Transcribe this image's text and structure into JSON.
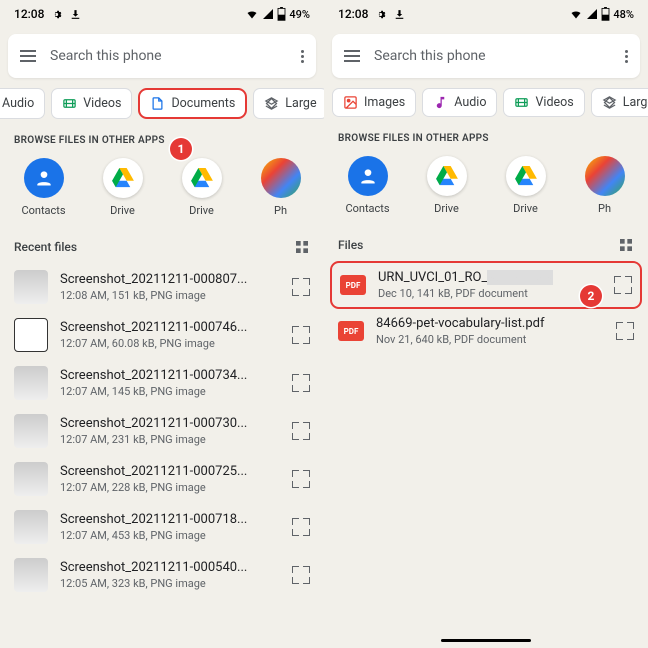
{
  "left": {
    "status": {
      "time": "12:08",
      "battery": "49%"
    },
    "search": {
      "placeholder": "Search this phone"
    },
    "chips": [
      {
        "icon": "audio",
        "label": "Audio",
        "color": "#9c27b0"
      },
      {
        "icon": "videos",
        "label": "Videos",
        "color": "#0f9d58"
      },
      {
        "icon": "documents",
        "label": "Documents",
        "color": "#1a73e8",
        "highlight": true
      },
      {
        "icon": "large",
        "label": "Large",
        "color": "#5f6368"
      }
    ],
    "browse_title": "BROWSE FILES IN OTHER APPS",
    "apps": [
      {
        "name": "Contacts",
        "type": "contacts"
      },
      {
        "name": "Drive",
        "type": "drive"
      },
      {
        "name": "Drive",
        "type": "drive"
      },
      {
        "name": "Ph",
        "type": "photos"
      }
    ],
    "files_header": "Recent files",
    "files": [
      {
        "name": "Screenshot_20211211-000807...",
        "meta": "12:08 AM, 151 kB, PNG image"
      },
      {
        "name": "Screenshot_20211211-000746...",
        "meta": "12:07 AM, 60.08 kB, PNG image"
      },
      {
        "name": "Screenshot_20211211-000734...",
        "meta": "12:07 AM, 145 kB, PNG image"
      },
      {
        "name": "Screenshot_20211211-000730...",
        "meta": "12:07 AM, 231 kB, PNG image"
      },
      {
        "name": "Screenshot_20211211-000725...",
        "meta": "12:07 AM, 228 kB, PNG image"
      },
      {
        "name": "Screenshot_20211211-000718...",
        "meta": "12:07 AM, 453 kB, PNG image"
      },
      {
        "name": "Screenshot_20211211-000540...",
        "meta": "12:05 AM, 323 kB, PNG image"
      }
    ],
    "callout": "1"
  },
  "right": {
    "status": {
      "time": "12:08",
      "battery": "48%"
    },
    "search": {
      "placeholder": "Search this phone"
    },
    "chips": [
      {
        "icon": "images",
        "label": "Images",
        "color": "#ea4335"
      },
      {
        "icon": "audio",
        "label": "Audio",
        "color": "#9c27b0"
      },
      {
        "icon": "videos",
        "label": "Videos",
        "color": "#0f9d58"
      },
      {
        "icon": "large",
        "label": "Large",
        "color": "#5f6368"
      }
    ],
    "browse_title": "BROWSE FILES IN OTHER APPS",
    "apps": [
      {
        "name": "Contacts",
        "type": "contacts"
      },
      {
        "name": "Drive",
        "type": "drive"
      },
      {
        "name": "Drive",
        "type": "drive"
      },
      {
        "name": "Ph",
        "type": "photos"
      }
    ],
    "files_header": "Files",
    "files": [
      {
        "name": "URN_UVCI_01_RO_",
        "meta": "Dec 10, 141 kB, PDF document",
        "badge": "PDF",
        "highlight": true,
        "redact": true
      },
      {
        "name": "84669-pet-vocabulary-list.pdf",
        "meta": "Nov 21, 640 kB, PDF document",
        "badge": "PDF"
      }
    ],
    "callout": "2"
  }
}
